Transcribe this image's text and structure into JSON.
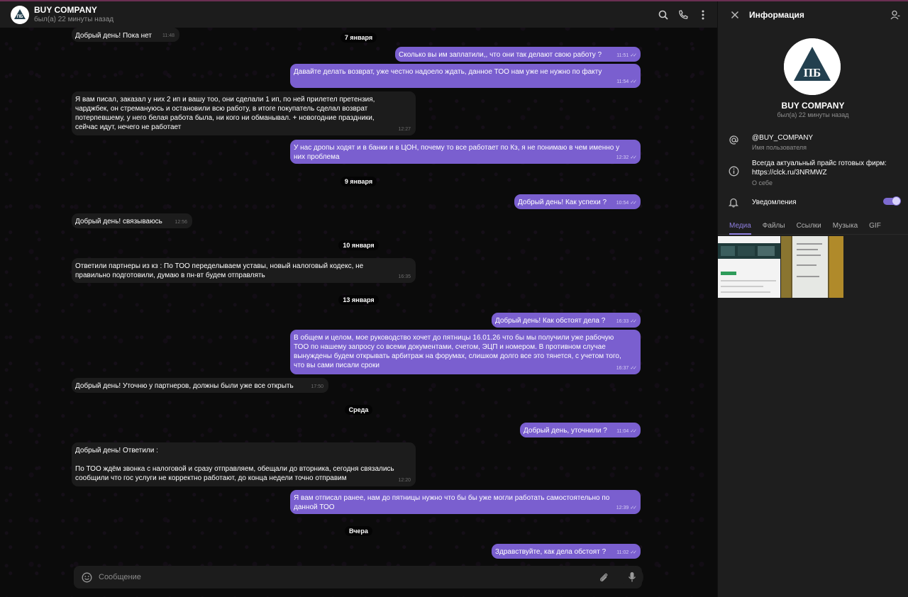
{
  "chat": {
    "title": "BUY COMPANY",
    "status": "был(а) 22 минуты назад",
    "composer_placeholder": "Сообщение",
    "dates": {
      "d7": "7 января",
      "d9": "9 января",
      "d10": "10 января",
      "d13": "13 января",
      "wed": "Среда",
      "yest": "Вчера"
    },
    "messages": [
      {
        "text": "Добрый день! Пока нет",
        "time": "11:48"
      },
      {
        "text": "Сколько вы им заплатили,, что они так делают свою работу ?",
        "time": "11:51"
      },
      {
        "text": "Давайте делать возврат, уже честно надоело ждать, данное ТОО нам уже не нужно по факту",
        "time": "11:54"
      },
      {
        "text": "Я вам писал, заказал у них 2 ип и вашу тоо, они сделали 1 ип, по ней прилетел претензия,\nчарджбек, он стремануюсь и остановили всю работу, в итоге покупатель сделал возврат\nпотерпевшему, у него белая работа была, ни кого ни обманывал. + новогодние праздники,\nсейчас идут, нечего не работает",
        "time": "12:27"
      },
      {
        "text": "У нас дропы ходят и в банки и в ЦОН, почему то все работает по Кз, я не понимаю в чем именно у\nних проблема",
        "time": "12:32"
      },
      {
        "text": "Добрый день! Как успехи ?",
        "time": "10:54"
      },
      {
        "text": "Добрый день! связываюсь",
        "time": "12:56"
      },
      {
        "text": "Ответили партнеры из кз : По ТОО переделываем уставы, новый налоговый кодекс, не\nправильно подготовили, думаю в пн-вт будем отправлять",
        "time": "16:35"
      },
      {
        "text": "Добрый день! Как обстоят дела ?",
        "time": "16:33"
      },
      {
        "text": "В общем и целом, мое руководство хочет до пятницы 16.01.26 что бы мы получили уже рабочую\nТОО по нашему запросу со всеми документами, счетом, ЭЦП и номером. В противном случае\nвынуждены будем открывать арбитраж на форумах, слишком долго все это тянется, с учетом того,\nчто вы сами писали сроки",
        "time": "16:37"
      },
      {
        "text": "Добрый день! Уточню у партнеров, должны были уже все открыть",
        "time": "17:50"
      },
      {
        "text": "Добрый день, уточнили ?",
        "time": "11:04"
      },
      {
        "text": "Добрый день! Ответили :\n\nПо ТОО ждём звонка с налоговой и сразу отправляем, обещали до вторника, сегодня связались\nсообщили что гос услуги не корректно работают, до конца недели точно отправим",
        "time": "12:20"
      },
      {
        "text": "Я вам отписал ранее, нам до пятницы нужно что бы бы уже могли работать самостоятельно по\nданной ТОО",
        "time": "12:39"
      },
      {
        "text": "Здравствуйте, как дела обстоят ?",
        "time": "11:02"
      }
    ]
  },
  "panel": {
    "title": "Информация",
    "name": "BUY COMPANY",
    "status": "был(а) 22 минуты назад",
    "username": "@BUY_COMPANY",
    "username_label": "Имя пользователя",
    "about": "Всегда актуальный прайс готовых фирм:\nhttps://clck.ru/3NRMWZ",
    "about_label": "О себе",
    "notifications": "Уведомления",
    "notifications_on": true,
    "tabs": [
      "Медиа",
      "Файлы",
      "Ссылки",
      "Музыка",
      "GIF"
    ]
  },
  "colors": {
    "accent": "#7a5fcf",
    "incoming": "#1c1c1c",
    "background": "#0b0b0b"
  },
  "icons": [
    "search-icon",
    "phone-icon",
    "more-icon",
    "close-icon",
    "contact-icon",
    "at-icon",
    "info-icon",
    "bell-icon",
    "emoji-icon",
    "attach-icon",
    "mic-icon"
  ]
}
